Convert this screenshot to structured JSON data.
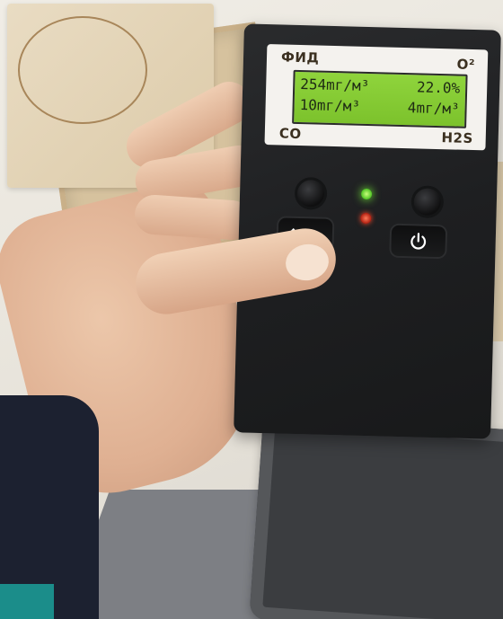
{
  "device": {
    "labels": {
      "top_left": "ФИД",
      "top_right": "O²",
      "bottom_left": "CO",
      "bottom_right": "H2S"
    },
    "display": {
      "row1_left": "254mг/м³",
      "row1_right": "22.0%",
      "row2_left": "10mг/м³",
      "row2_right": "4mг/м³"
    },
    "leds": {
      "top": "green",
      "bottom": "red"
    },
    "buttons": {
      "left_icon": "left-arrow-icon",
      "right_icon": "power-icon"
    }
  },
  "colors": {
    "lcd_background": "#8fd43c",
    "device_body": "#1e1f21",
    "led_green": "#4fc424",
    "led_red": "#b01e10"
  }
}
